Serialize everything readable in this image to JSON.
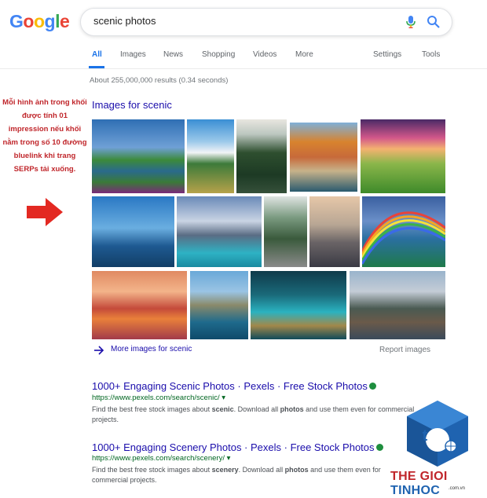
{
  "search": {
    "query": "scenic photos"
  },
  "logo": {
    "letters": [
      "G",
      "o",
      "o",
      "g",
      "l",
      "e"
    ],
    "colors": [
      "#4285f4",
      "#ea4335",
      "#fbbc05",
      "#4285f4",
      "#34a853",
      "#ea4335"
    ]
  },
  "tabs": [
    {
      "label": "All"
    },
    {
      "label": "Images"
    },
    {
      "label": "News"
    },
    {
      "label": "Shopping"
    },
    {
      "label": "Videos"
    },
    {
      "label": "More"
    },
    {
      "label": "Settings"
    },
    {
      "label": "Tools"
    }
  ],
  "stats": "About 255,000,000 results (0.34 seconds)",
  "annotation": "Mỗi hình ảnh trong khối được tính 01 impression nếu khối nằm trong số 10 đường bluelink khi trang SERPs tải xuống.",
  "images_block": {
    "heading": "Images for scenic",
    "more_label": "More images for scenic",
    "report_label": "Report images"
  },
  "results": [
    {
      "title": "1000+ Engaging Scenic Photos · Pexels · Free Stock Photos",
      "url": "https://www.pexels.com/search/scenic/",
      "snippet_parts": [
        "Find the best free stock images about ",
        "scenic",
        ". Download all ",
        "photos",
        " and use them even for commercial projects."
      ]
    },
    {
      "title": "1000+ Engaging Scenery Photos · Pexels · Free Stock Photos",
      "url": "https://www.pexels.com/search/scenery/",
      "snippet_parts": [
        "Find the best free stock images about ",
        "scenery",
        ". Download all ",
        "photos",
        " and use them even for commercial projects."
      ]
    }
  ],
  "watermark": {
    "the": "THE",
    "gioi": "GIOI",
    "tinhoc": "TINHOC",
    "sub": ".com.vn",
    "letter": "t"
  },
  "colors": {
    "link": "#1a0dab",
    "url": "#006621",
    "accent": "#1a73e8",
    "annotation": "#c0262b"
  }
}
